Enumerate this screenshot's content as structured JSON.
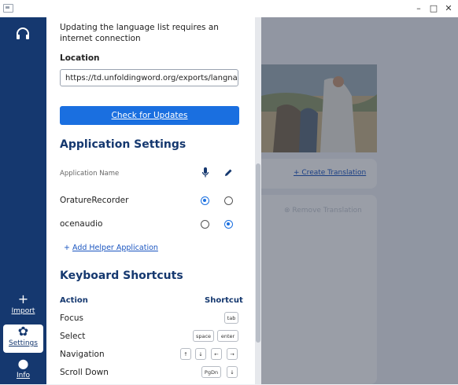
{
  "window": {
    "controls": {
      "minimize": "–",
      "maximize": "□",
      "close": "✕"
    }
  },
  "sidebar": {
    "import_label": "Import",
    "settings_label": "Settings",
    "info_label": "Info"
  },
  "background": {
    "create_translation_label": "+ Create Translation",
    "remove_translation_label": "Remove Translation"
  },
  "settings": {
    "update_note": "Updating the language list requires an internet connection",
    "location_label": "Location",
    "location_value": "https://td.unfoldingword.org/exports/langnames.json",
    "check_updates_label": "Check for Updates",
    "app_settings_title": "Application Settings",
    "app_name_header": "Application Name",
    "apps": [
      {
        "name": "OratureRecorder",
        "record": true,
        "edit": false
      },
      {
        "name": "ocenaudio",
        "record": false,
        "edit": true
      }
    ],
    "add_helper_label": "Add Helper Application",
    "add_helper_plus": "+",
    "keyboard_title": "Keyboard Shortcuts",
    "kb_action_header": "Action",
    "kb_shortcut_header": "Shortcut",
    "shortcuts": [
      {
        "action": "Focus",
        "keys": [
          "tab"
        ]
      },
      {
        "action": "Select",
        "keys": [
          "space",
          "enter"
        ]
      },
      {
        "action": "Navigation",
        "keys": [
          "↑",
          "↓",
          "←",
          "→"
        ]
      },
      {
        "action": "Scroll Down",
        "keys": [
          "PgDn",
          "↓"
        ]
      }
    ]
  },
  "colors": {
    "rail": "#15386f",
    "accent": "#1a6fe0"
  }
}
